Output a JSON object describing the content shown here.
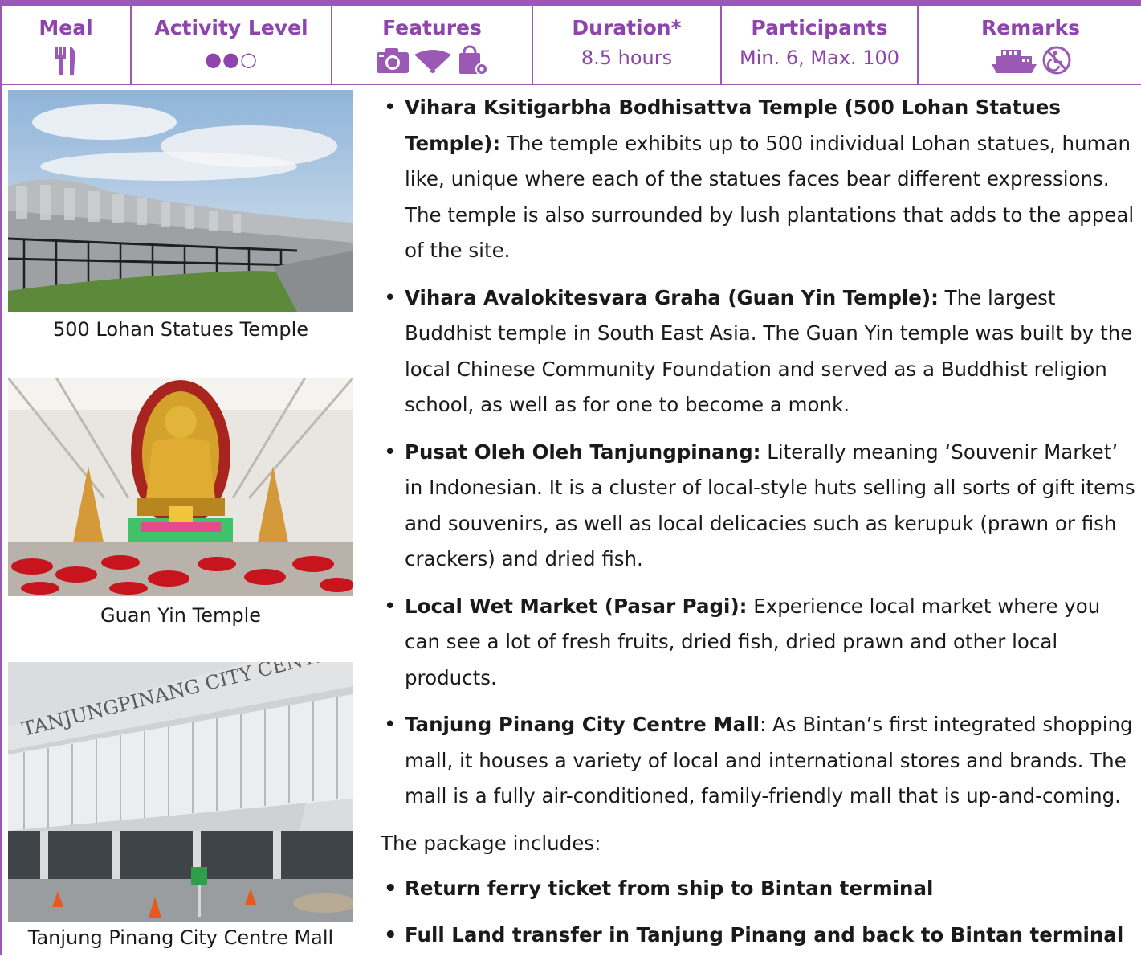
{
  "header": {
    "columns": [
      {
        "title": "Meal",
        "icon": "fork-knife-icon"
      },
      {
        "title": "Activity Level",
        "value": "●●○"
      },
      {
        "title": "Features",
        "icons": [
          "camera-icon",
          "fan-icon",
          "shopping-bag-icon"
        ]
      },
      {
        "title": "Duration*",
        "value": "8.5 hours"
      },
      {
        "title": "Participants",
        "value": "Min. 6, Max. 100"
      },
      {
        "title": "Remarks",
        "icons": [
          "ferry-icon",
          "no-wheelchair-icon"
        ]
      }
    ]
  },
  "photos": [
    {
      "caption": "500 Lohan Statues Temple"
    },
    {
      "caption": "Guan Yin Temple"
    },
    {
      "caption": "Tanjung Pinang City Centre Mall",
      "sign_text": "TANJUNGPINANG CITY CENTER"
    }
  ],
  "attractions": [
    {
      "name": "Vihara Ksitigarbha Bodhisattva Temple (500 Lohan Statues Temple):",
      "text": " The temple exhibits up to 500 individual Lohan statues, human like, unique where each of the statues faces bear different expressions. The temple is also surrounded by lush plantations that adds to the appeal of the site."
    },
    {
      "name": "Vihara Avalokitesvara Graha (Guan Yin Temple):",
      "text": " The largest Buddhist temple in South East Asia. The Guan Yin temple was built by the local Chinese Community Foundation and served as a Buddhist religion school, as well as for one to become a monk."
    },
    {
      "name": "Pusat Oleh Oleh Tanjungpinang:",
      "text": " Literally meaning ‘Souvenir Market’ in Indonesian. It is a cluster of local-style huts selling all sorts of gift items and souvenirs, as well as local delicacies such as kerupuk (prawn or fish crackers) and dried fish."
    },
    {
      "name": "Local Wet Market (Pasar Pagi):",
      "text": " Experience local market where you can see a lot of fresh fruits, dried fish, dried prawn and other local products."
    },
    {
      "name": "Tanjung Pinang City Centre Mall",
      "text": ": As Bintan’s first integrated shopping mall, it houses a variety of local and international stores and brands. The mall is a fully air-conditioned, family-friendly mall that is up-and-coming."
    }
  ],
  "package": {
    "intro": "The package includes:",
    "items": [
      "Return ferry ticket from ship to Bintan terminal",
      "Full Land transfer in Tanjung Pinang and back to Bintan terminal"
    ]
  },
  "colors": {
    "accent": "#8e44ad",
    "border": "#9b59b6"
  }
}
